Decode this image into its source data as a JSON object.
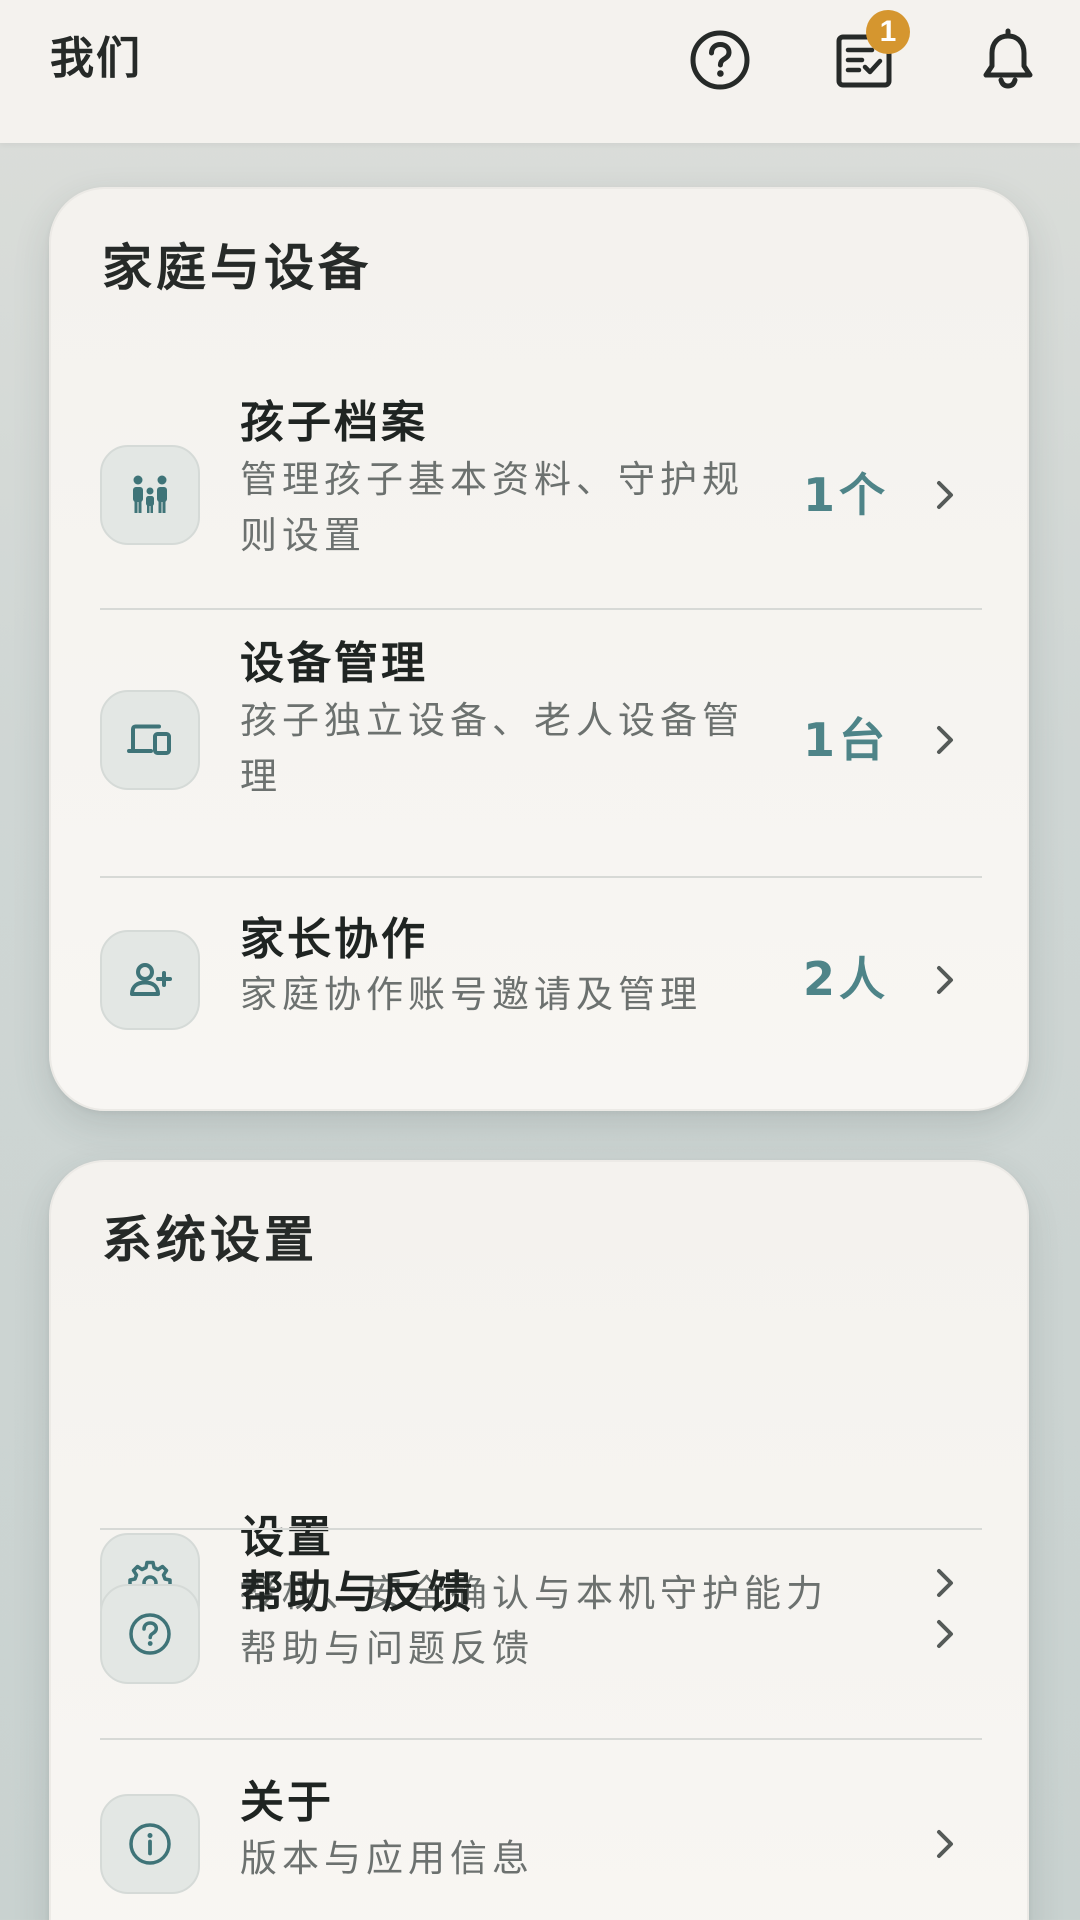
{
  "header": {
    "title": "我们",
    "help_icon": "help-circle-icon",
    "tasks_icon": "task-checklist-icon",
    "tasks_badge": "1",
    "notifications_icon": "bell-icon"
  },
  "family": {
    "title": "家庭与设备",
    "items": [
      {
        "icon": "family-icon",
        "title": "孩子档案",
        "subtitle": "管理孩子基本资料、守护规则设置",
        "count": "1个"
      },
      {
        "icon": "devices-icon",
        "title": "设备管理",
        "subtitle": "孩子独立设备、老人设备管理",
        "count": "1台"
      },
      {
        "icon": "add-person-icon",
        "title": "家长协作",
        "subtitle": "家庭协作账号邀请及管理",
        "count": "2人"
      }
    ]
  },
  "system": {
    "title": "系统设置",
    "items": [
      {
        "icon": "gear-icon",
        "title": "设置",
        "subtitle": "授权、安全确认与本机守护能力"
      },
      {
        "icon": "help-circle-icon",
        "title": "帮助与反馈",
        "subtitle": "帮助与问题反馈"
      },
      {
        "icon": "info-icon",
        "title": "关于",
        "subtitle": "版本与应用信息"
      }
    ]
  },
  "colors": {
    "accent": "#4e8488",
    "badge": "#d5962f",
    "icon": "#3f7478",
    "background": "#cfd6d4",
    "card": "#f6f4f0"
  }
}
